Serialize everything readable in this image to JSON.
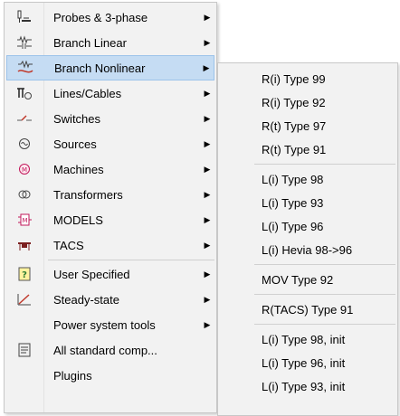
{
  "main_menu": {
    "items": [
      {
        "label": "Probes & 3-phase",
        "icon": "probe-icon",
        "has_submenu": true
      },
      {
        "label": "Branch Linear",
        "icon": "branch-linear-icon",
        "has_submenu": true
      },
      {
        "label": "Branch Nonlinear",
        "icon": "branch-nonlinear-icon",
        "has_submenu": true,
        "selected": true
      },
      {
        "label": "Lines/Cables",
        "icon": "lines-cables-icon",
        "has_submenu": true
      },
      {
        "label": "Switches",
        "icon": "switch-icon",
        "has_submenu": true
      },
      {
        "label": "Sources",
        "icon": "source-icon",
        "has_submenu": true
      },
      {
        "label": "Machines",
        "icon": "machine-icon",
        "has_submenu": true
      },
      {
        "label": "Transformers",
        "icon": "transformer-icon",
        "has_submenu": true
      },
      {
        "label": "MODELS",
        "icon": "models-icon",
        "has_submenu": true
      },
      {
        "label": "TACS",
        "icon": "tacs-icon",
        "has_submenu": true
      },
      {
        "label": "User Specified",
        "icon": "user-specified-icon",
        "has_submenu": true
      },
      {
        "label": "Steady-state",
        "icon": "steady-state-icon",
        "has_submenu": true
      },
      {
        "label": "Power system tools",
        "icon": "",
        "has_submenu": true
      },
      {
        "label": "All standard comp...",
        "icon": "document-icon",
        "has_submenu": false
      },
      {
        "label": "Plugins",
        "icon": "",
        "has_submenu": false
      }
    ],
    "arrow": "▶"
  },
  "submenu": {
    "items": [
      {
        "label": "R(i) Type 99"
      },
      {
        "label": "R(i) Type 92"
      },
      {
        "label": "R(t) Type 97"
      },
      {
        "label": "R(t) Type 91"
      },
      {
        "label": "L(i) Type 98"
      },
      {
        "label": "L(i) Type 93"
      },
      {
        "label": "L(i) Type 96"
      },
      {
        "label": "L(i) Hevia 98->96"
      },
      {
        "label": "MOV Type 92"
      },
      {
        "label": "R(TACS) Type 91"
      },
      {
        "label": "L(i) Type 98, init"
      },
      {
        "label": "L(i) Type 96, init"
      },
      {
        "label": "L(i) Type 93, init"
      }
    ]
  },
  "colors": {
    "selected_bg": "#c5dcf3",
    "selected_border": "#9cc3ea",
    "menu_bg": "#f2f2f2"
  }
}
